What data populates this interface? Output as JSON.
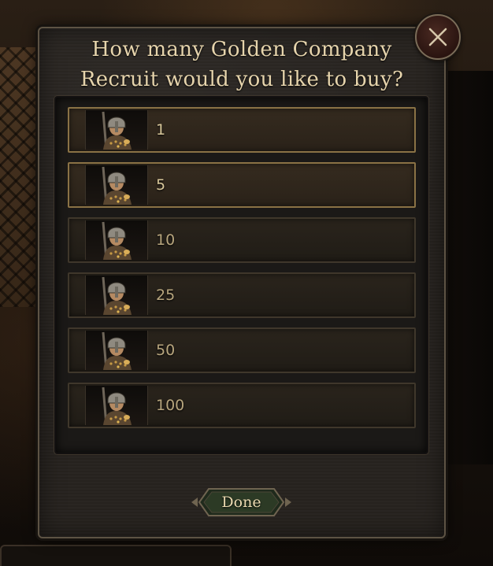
{
  "dialog": {
    "title_line1": "How many Golden Company",
    "title_line2": "Recruit would you like to buy?"
  },
  "close_button": {
    "icon": "close-icon"
  },
  "options": [
    {
      "label": "1",
      "icon": "soldier-portrait-icon"
    },
    {
      "label": "5",
      "icon": "soldier-portrait-icon"
    },
    {
      "label": "10",
      "icon": "soldier-portrait-icon"
    },
    {
      "label": "25",
      "icon": "soldier-portrait-icon"
    },
    {
      "label": "50",
      "icon": "soldier-portrait-icon"
    },
    {
      "label": "100",
      "icon": "soldier-portrait-icon"
    }
  ],
  "footer": {
    "done_label": "Done"
  },
  "colors": {
    "accent_gold": "#e6d4ac",
    "frame_border": "#5d5344",
    "close_red": "#4a2a22"
  }
}
